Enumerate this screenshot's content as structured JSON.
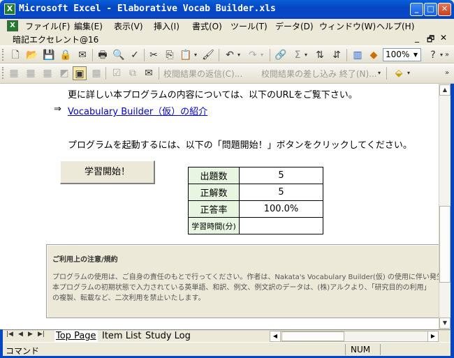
{
  "window": {
    "title": "Microsoft Excel - Elaborative Vocab Builder.xls",
    "app_icon": "excel-icon",
    "minimize_glyph": "_",
    "maximize_glyph": "□",
    "close_glyph": "✕"
  },
  "menubar": {
    "items": [
      "ファイル(F)",
      "編集(E)",
      "表示(V)",
      "挿入(I)",
      "書式(O)",
      "ツール(T)",
      "データ(D)",
      "ウィンドウ(W)",
      "ヘルプ(H)"
    ]
  },
  "namebar": {
    "name": "暗記エクセレント@16",
    "min_glyph": "_",
    "restore_glyph": "🗗",
    "close_glyph": "✕"
  },
  "toolbar": {
    "zoom": "100%",
    "review_reply_label": "校閲結果の返信(C)...",
    "review_end_label": "校閲結果の差し込み 終了(N)..."
  },
  "sheet": {
    "line1": "更に詳しい本プログラムの内容については、以下のURLをご覧下さい。",
    "arrow": "⇒",
    "link_text": "Vocabulary Builder（仮）の紹介",
    "instruction": "プログラムを起動するには、以下の「問題開始！」ボタンをクリックしてください。",
    "start_button": "学習開始！",
    "stats": [
      {
        "label": "出題数",
        "value": "5"
      },
      {
        "label": "正解数",
        "value": "5"
      },
      {
        "label": "正答率",
        "value": "100.0%"
      },
      {
        "label": "学習時間(分)",
        "value": ""
      }
    ],
    "notice": {
      "title": "ご利用上の注意/規約",
      "line1": "プログラムの使用は、ご自身の責任のもとで行ってください。作者は、Nakata's Vocabulary Builder(仮) の使用に伴い発生",
      "line2": "本プログラムの初期状態で入力されている英単語、和訳、例文、例文訳のデータは、(株)アルクより、「研究目的の利用」",
      "line3": "の複製、転載など、二次利用を禁止いたします。"
    }
  },
  "tabs": {
    "items": [
      "Top Page",
      "Item List",
      "Study Log"
    ],
    "active": "Top Page"
  },
  "status": {
    "mode": "コマンド",
    "num": "NUM"
  }
}
